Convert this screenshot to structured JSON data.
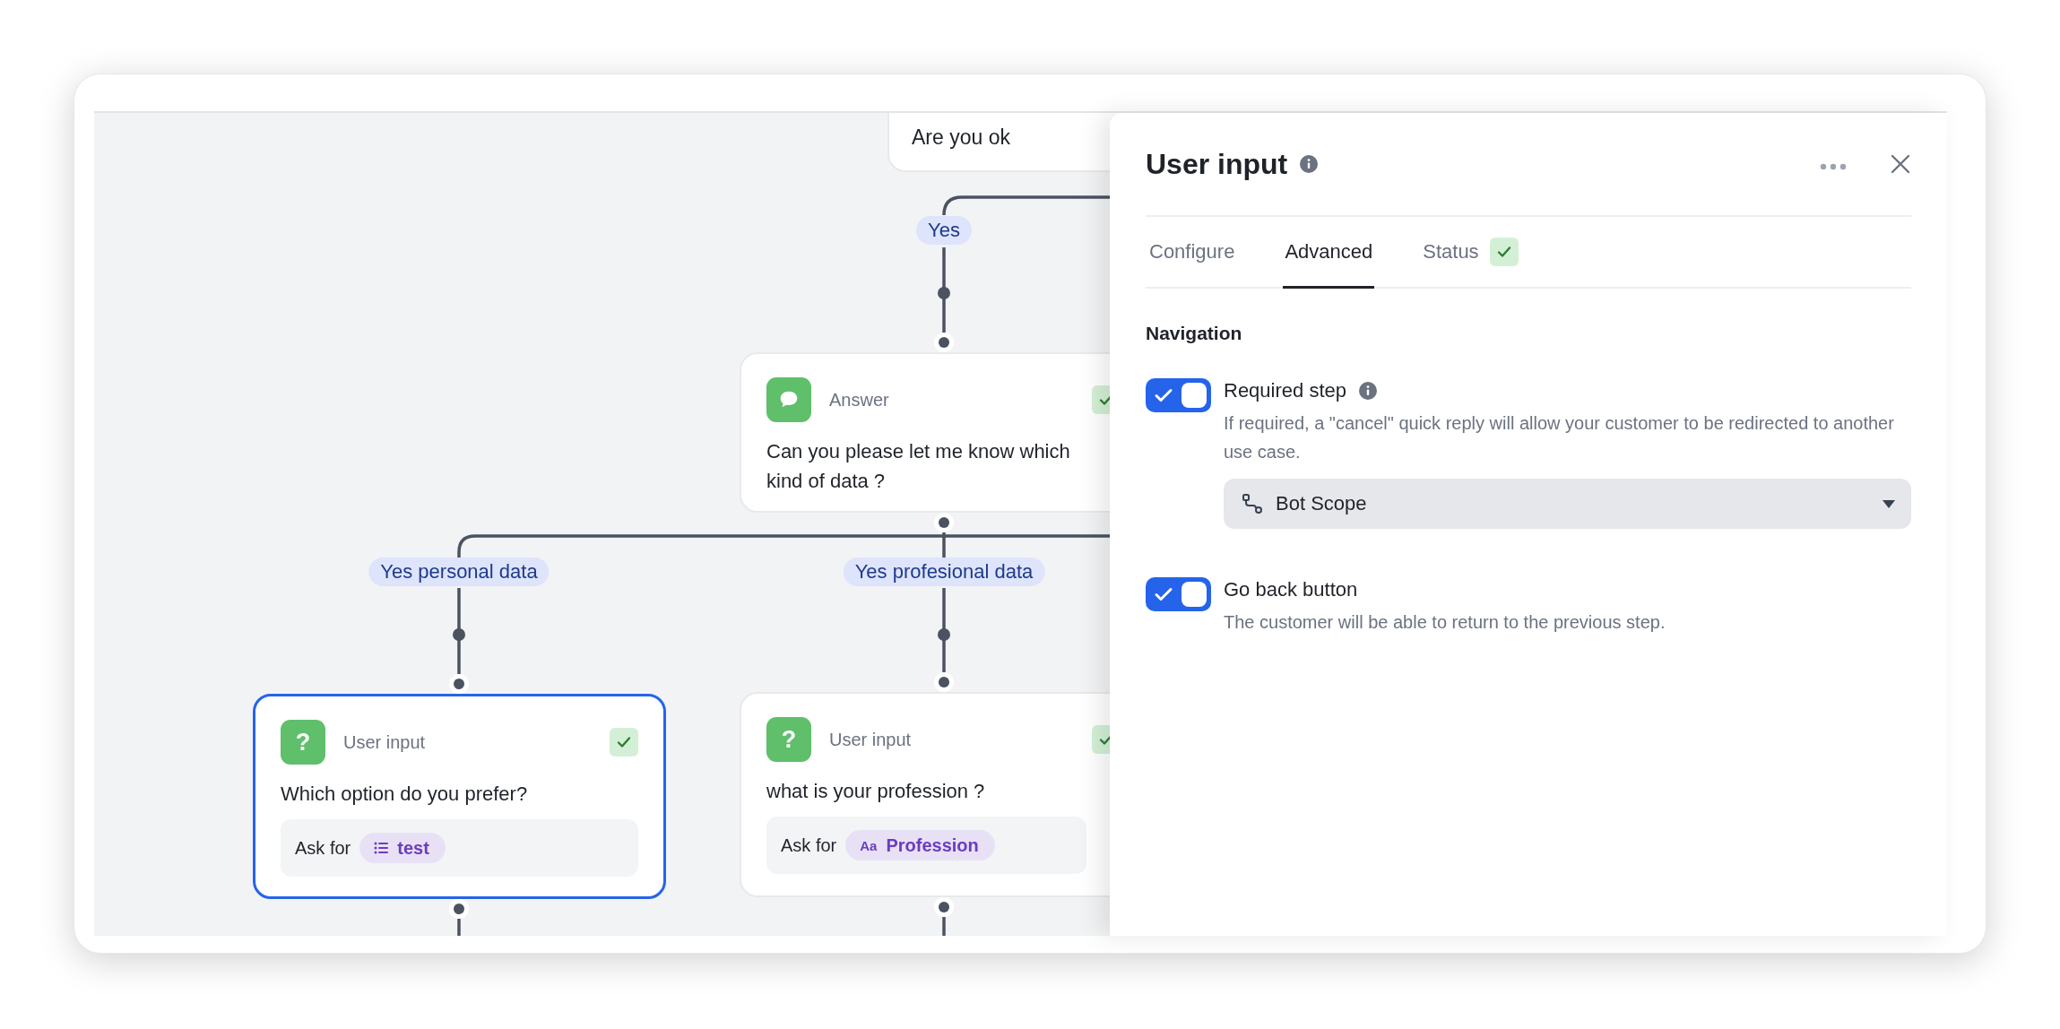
{
  "canvas": {
    "nodes": [
      {
        "kind": "message",
        "text": "Are you ok",
        "selected": false
      },
      {
        "kind": "answer",
        "type_label": "Answer",
        "text": "Can you please let me know which kind of data ?",
        "valid": true,
        "selected": false
      },
      {
        "kind": "user_input",
        "icon": "?",
        "type_label": "User input",
        "text": "Which option do you prefer?",
        "ask_label": "Ask for",
        "variable": {
          "kind": "list",
          "name": "test"
        },
        "valid": true,
        "selected": true
      },
      {
        "kind": "user_input",
        "icon": "?",
        "type_label": "User input",
        "text": "what is your profession ?",
        "ask_label": "Ask for",
        "variable": {
          "kind": "text",
          "icon": "Aa",
          "name": "Profession"
        },
        "valid": true,
        "selected": false
      }
    ],
    "branch_labels": [
      "Yes",
      "Yes personal data",
      "Yes profesional data"
    ]
  },
  "panel": {
    "title": "User input",
    "tabs": [
      {
        "label": "Configure",
        "selected": false
      },
      {
        "label": "Advanced",
        "selected": true
      },
      {
        "label": "Status",
        "selected": false,
        "valid": true
      }
    ],
    "section": "Navigation",
    "settings": [
      {
        "label": "Required step",
        "info": true,
        "on": true,
        "description": "If required, a \"cancel\" quick reply will allow your customer to be redirected to another use case.",
        "dropdown": {
          "value": "Bot Scope"
        }
      },
      {
        "label": "Go back button",
        "info": false,
        "on": true,
        "description": "The customer will be able to return to the previous step."
      }
    ]
  }
}
